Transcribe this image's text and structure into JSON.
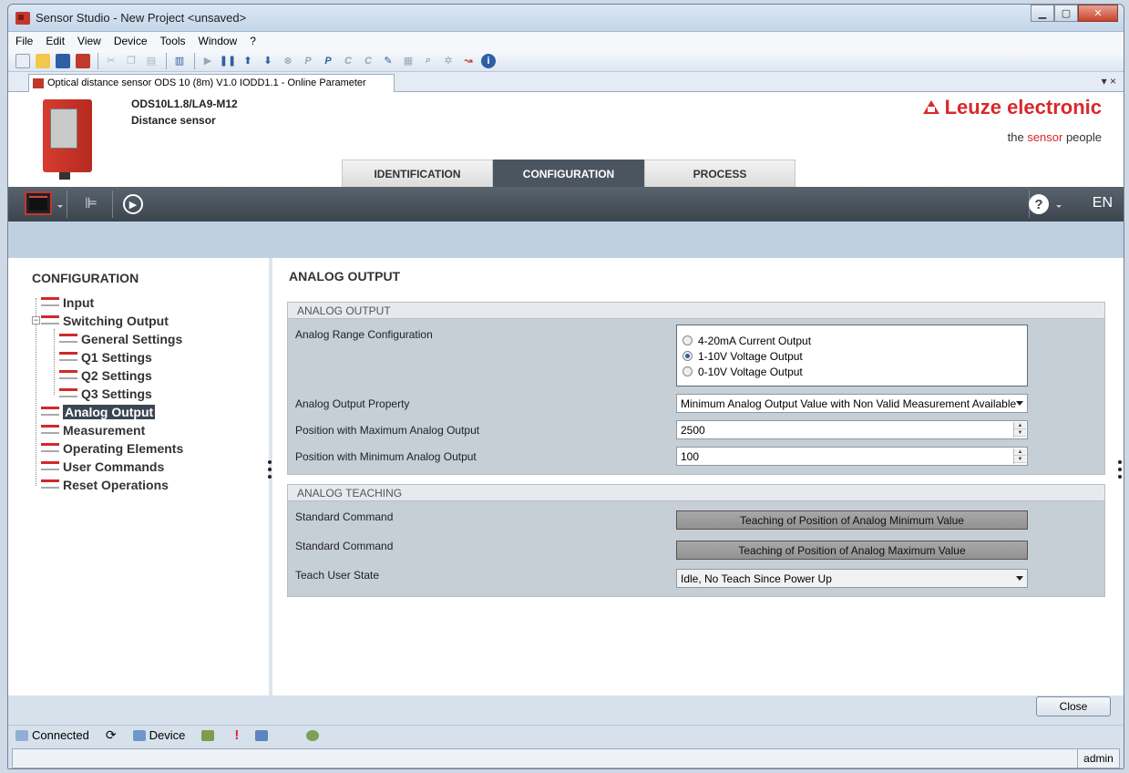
{
  "window": {
    "title": "Sensor Studio - New Project  <unsaved>"
  },
  "menu": [
    "File",
    "Edit",
    "View",
    "Device",
    "Tools",
    "Window",
    "?"
  ],
  "doc_tab": {
    "label": "Optical distance sensor ODS 10 (8m) V1.0 IODD1.1 - Online Parameter",
    "controls": "▾  ×"
  },
  "device": {
    "model": "ODS10L1.8/LA9-M12",
    "type": "Distance sensor"
  },
  "brand": {
    "name_part1": "Leuze ",
    "name_part2": "electronic",
    "tagline_a": "the ",
    "tagline_b": "sensor",
    "tagline_c": " people"
  },
  "nav_tabs": [
    "IDENTIFICATION",
    "CONFIGURATION",
    "PROCESS"
  ],
  "toolbar2": {
    "lang": "EN",
    "help": "?"
  },
  "sidebar": {
    "title": "CONFIGURATION",
    "items": [
      "Input",
      "Switching Output",
      "General Settings",
      "Q1 Settings",
      "Q2 Settings",
      "Q3 Settings",
      "Analog Output",
      "Measurement",
      "Operating Elements",
      "User Commands",
      "Reset Operations"
    ],
    "expander": "−"
  },
  "main": {
    "title": "ANALOG OUTPUT",
    "group1": {
      "header": "ANALOG OUTPUT",
      "range_label": "Analog Range Configuration",
      "radio_options": [
        "4-20mA Current Output",
        "1-10V  Voltage Output",
        "0-10V  Voltage Output"
      ],
      "selected_radio": 1,
      "property_label": "Analog Output Property",
      "property_value": "Minimum Analog Output Value with Non Valid Measurement Available",
      "max_label": "Position with Maximum Analog Output",
      "max_value": "2500",
      "min_label": "Position with Minimum Analog Output",
      "min_value": "100"
    },
    "group2": {
      "header": "ANALOG TEACHING",
      "cmd1_label": "Standard Command",
      "cmd1_button": "Teaching of Position of Analog Minimum Value",
      "cmd2_label": "Standard Command",
      "cmd2_button": "Teaching of Position of Analog Maximum Value",
      "state_label": "Teach User State",
      "state_value": "Idle, No Teach Since Power Up"
    }
  },
  "footer": {
    "close_label": "Close",
    "status": {
      "connected": "Connected",
      "device": "Device",
      "alert": "!"
    },
    "user": "admin"
  }
}
